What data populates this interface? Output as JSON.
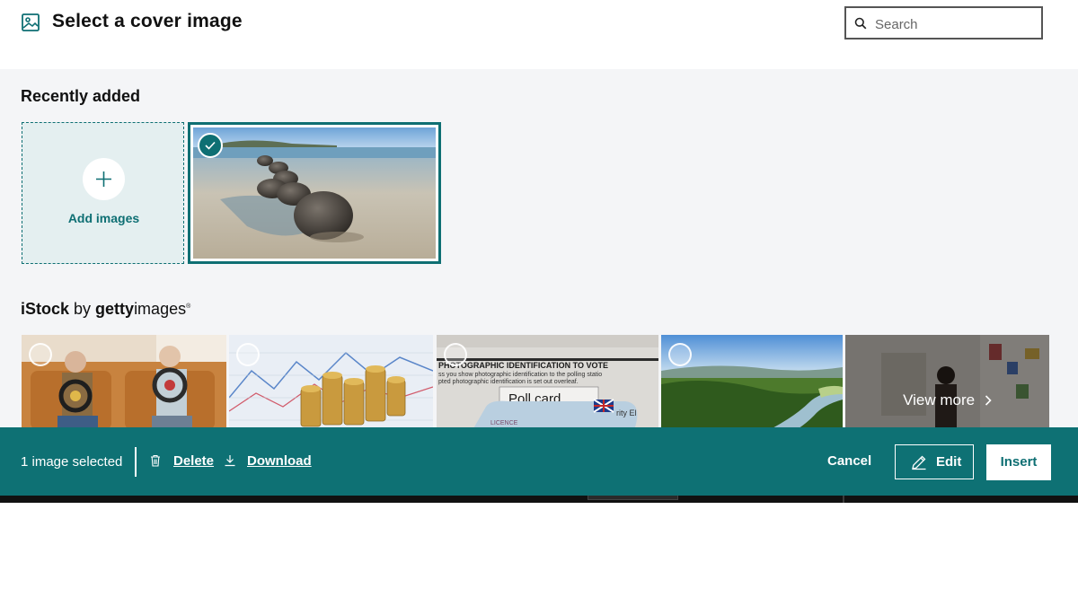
{
  "header": {
    "title": "Select a cover image",
    "icon": "image-icon",
    "search": {
      "placeholder": "Search",
      "value": "",
      "icon": "search-icon"
    }
  },
  "recent": {
    "title": "Recently added",
    "add_label": "Add images",
    "add_icon": "plus-icon",
    "images": [
      {
        "description_icon": "beach-boulders-photo",
        "selected": true
      }
    ]
  },
  "istock": {
    "brand_strong": "iStock",
    "brand_by": " by ",
    "brand_getty": "getty",
    "brand_images": "images",
    "brand_reg": "®",
    "tiles": [
      {
        "name": "seniors-driving-photo",
        "selected": false
      },
      {
        "name": "coins-chart-photo",
        "selected": false
      },
      {
        "name": "poll-card-photo",
        "selected": false
      },
      {
        "name": "river-valley-photo",
        "selected": false
      }
    ],
    "view_more": "View more"
  },
  "footer": {
    "count": "1 image selected",
    "delete": "Delete",
    "download": "Download",
    "cancel": "Cancel",
    "edit": "Edit",
    "insert": "Insert"
  },
  "colors": {
    "accent": "#0e7174",
    "panel": "#f4f5f7",
    "tile_bg": "#e4eff0"
  }
}
